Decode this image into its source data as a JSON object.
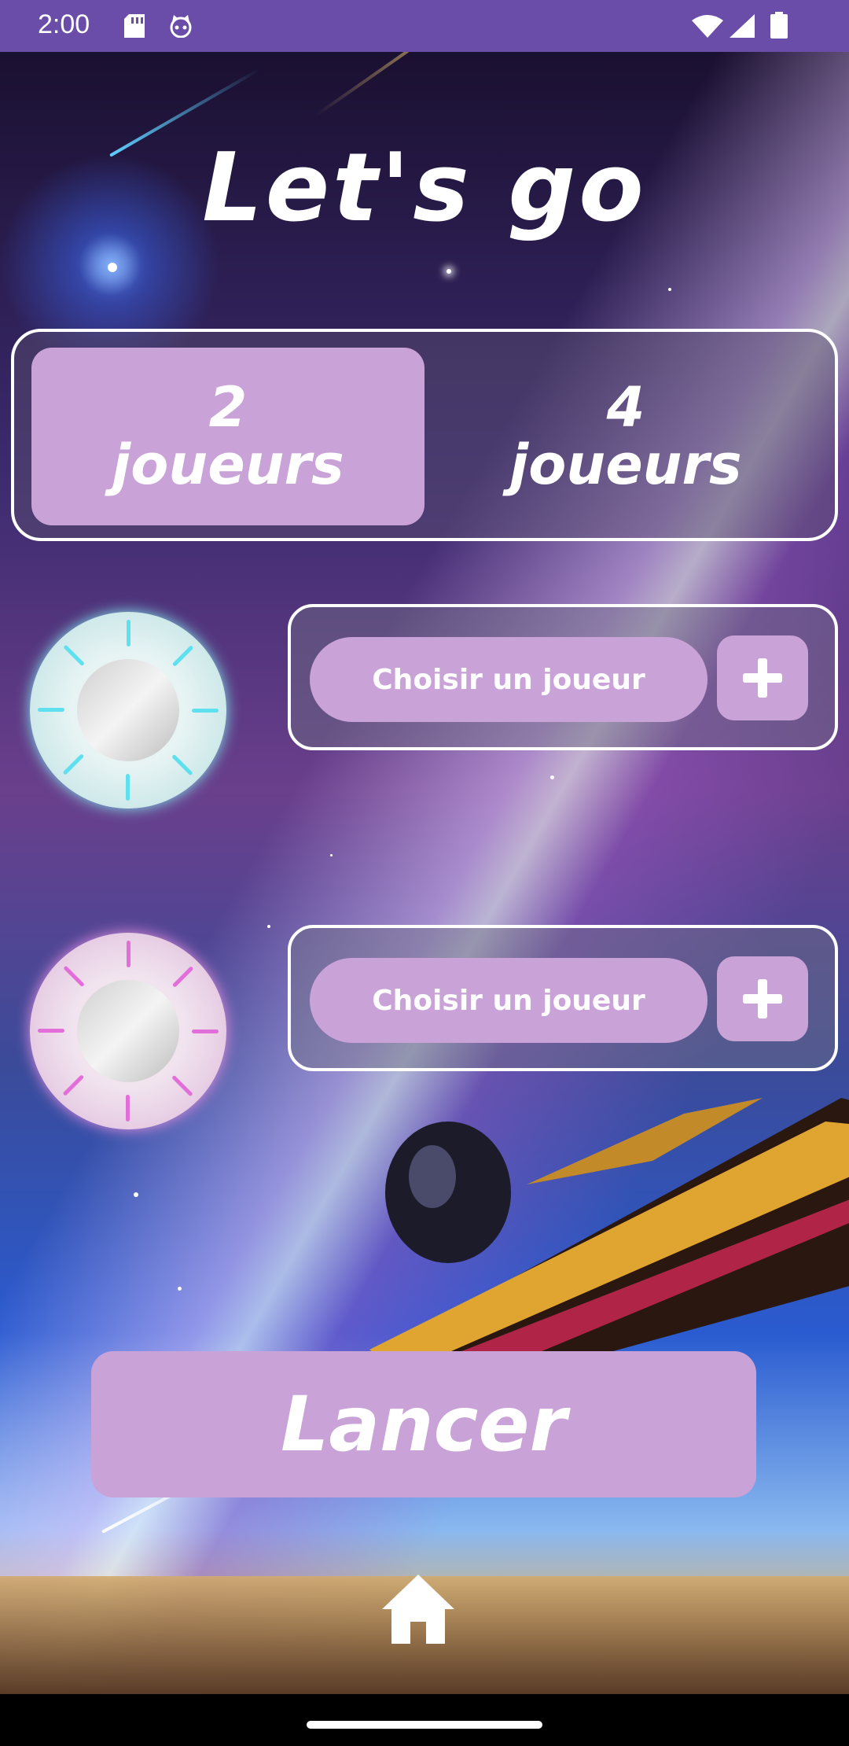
{
  "status_bar": {
    "time": "2:00",
    "icons": [
      "sd-card-icon",
      "cat-icon",
      "wifi-icon",
      "signal-icon",
      "battery-icon"
    ]
  },
  "screen": {
    "title": "Let's go"
  },
  "player_count": {
    "options": [
      {
        "number": "2",
        "label": "joueurs",
        "selected": true
      },
      {
        "number": "4",
        "label": "joueurs",
        "selected": false
      }
    ]
  },
  "players": [
    {
      "avatar_color": "#5fe0ee",
      "choose_label": "Choisir un joueur",
      "add_icon": "plus-icon"
    },
    {
      "avatar_color": "#e26fd9",
      "choose_label": "Choisir un joueur",
      "add_icon": "plus-icon"
    }
  ],
  "launch": {
    "label": "Lancer"
  },
  "bottom": {
    "icon": "home-icon"
  },
  "colors": {
    "accent": "#c9a3d8",
    "status_bar": "#6a4da8"
  }
}
